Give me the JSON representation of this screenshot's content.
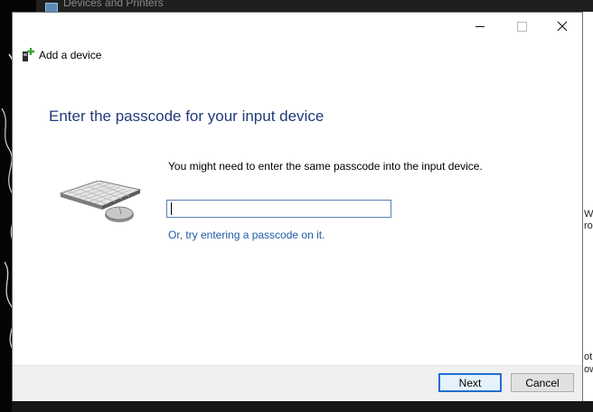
{
  "background_window": {
    "title": "Devices and Printers",
    "side_fragments": [
      "Wi",
      "ro",
      "ot",
      "ow"
    ]
  },
  "dialog": {
    "app_title": "Add a device",
    "heading": "Enter the passcode for your input device",
    "instruction": "You might need to enter the same passcode into the input device.",
    "passcode": {
      "value": "",
      "placeholder": ""
    },
    "alt_link": "Or, try entering a passcode on it.",
    "buttons": {
      "next": "Next",
      "cancel": "Cancel"
    },
    "icons": {
      "app": "add-device-icon",
      "device": "keyboard-mouse-icon",
      "minimize": "minimize-icon",
      "maximize": "maximize-icon",
      "close": "close-icon"
    },
    "colors": {
      "heading": "#1f3b79",
      "link": "#1f5aa3",
      "default_button_border": "#1f6fcf"
    }
  }
}
